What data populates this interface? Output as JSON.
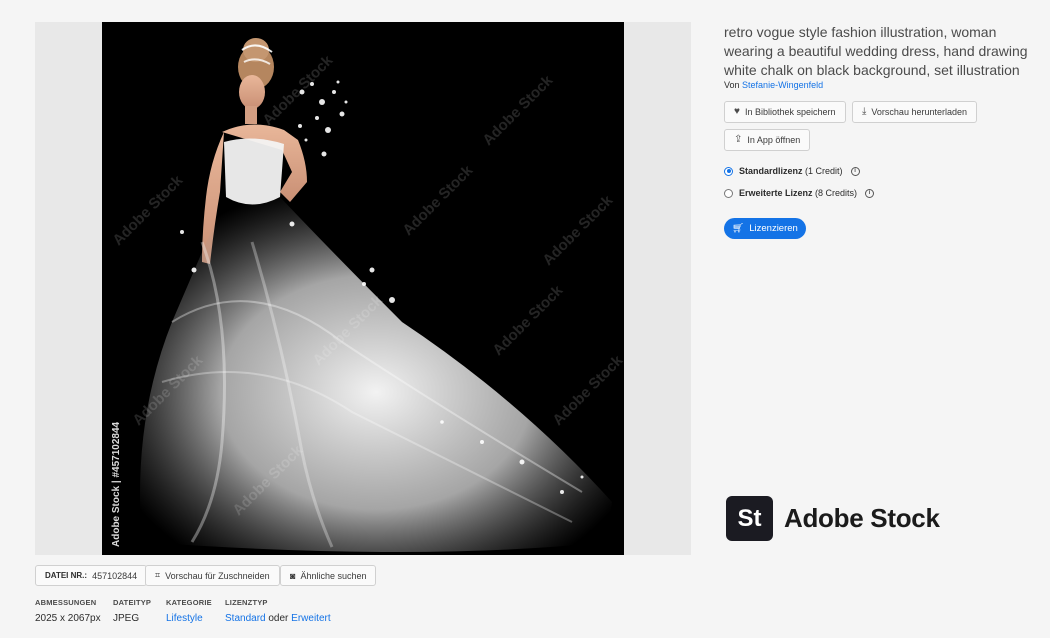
{
  "asset": {
    "title": "retro vogue style fashion illustration, woman wearing a beautiful wedding dress, hand drawing white chalk on black background, set illustration",
    "by_prefix": "Von",
    "author": "Stefanie-Wingenfeld",
    "watermark_text": "Adobe Stock",
    "side_watermark": "Adobe Stock | #457102844"
  },
  "actions": {
    "save_library": "In Bibliothek speichern",
    "download_preview": "Vorschau herunterladen",
    "open_app": "In App öffnen"
  },
  "licenses": {
    "standard_label": "Standardlizenz",
    "standard_credits": "(1 Credit)",
    "extended_label": "Erweiterte Lizenz",
    "extended_credits": "(8 Credits)",
    "license_button": "Lizenzieren"
  },
  "logo": {
    "mark": "St",
    "text": "Adobe Stock"
  },
  "bottom": {
    "file_nr_label": "DATEI NR.:",
    "file_nr_value": "457102844",
    "crop_preview": "Vorschau für Zuschneiden",
    "find_similar": "Ähnliche suchen"
  },
  "meta": {
    "dimensions_label": "ABMESSUNGEN",
    "dimensions_value": "2025 x 2067px",
    "filetype_label": "DATEITYP",
    "filetype_value": "JPEG",
    "category_label": "KATEGORIE",
    "category_value": "Lifestyle",
    "licensetype_label": "LIZENZTYP",
    "license_standard": "Standard",
    "license_or": "oder",
    "license_extended": "Erweitert"
  },
  "colors": {
    "accent": "#1473e6",
    "image_bg": "#000000",
    "logo_bg": "#1b1b22"
  },
  "icons": [
    "heart-icon",
    "download-icon",
    "share-icon",
    "info-icon",
    "cart-icon",
    "crop-icon",
    "camera-icon"
  ]
}
